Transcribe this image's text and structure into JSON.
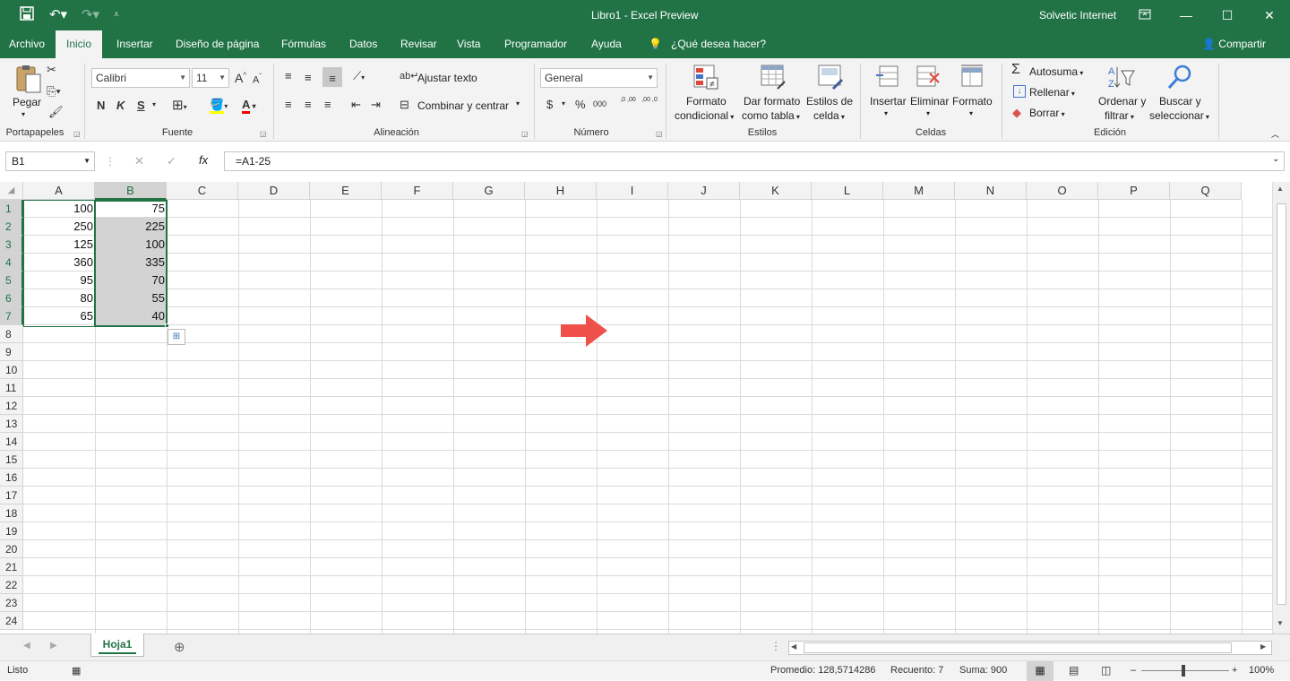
{
  "titlebar": {
    "quick_access": [
      "save-icon",
      "undo-icon",
      "redo-icon",
      "customize-icon"
    ],
    "title": "Libro1  -  Excel Preview",
    "account": "Solvetic Internet",
    "window_controls": [
      "ribbon-display-icon",
      "minimize-icon",
      "maximize-icon",
      "close-icon"
    ]
  },
  "tabs": [
    {
      "label": "Archivo"
    },
    {
      "label": "Inicio",
      "active": true
    },
    {
      "label": "Insertar"
    },
    {
      "label": "Diseño de página"
    },
    {
      "label": "Fórmulas"
    },
    {
      "label": "Datos"
    },
    {
      "label": "Revisar"
    },
    {
      "label": "Vista"
    },
    {
      "label": "Programador"
    },
    {
      "label": "Ayuda"
    }
  ],
  "tellme": "¿Qué desea hacer?",
  "share": "Compartir",
  "ribbon": {
    "clipboard": {
      "paste": "Pegar",
      "group": "Portapapeles"
    },
    "font": {
      "name": "Calibri",
      "size": "11",
      "bold": "N",
      "italic": "K",
      "underline": "S",
      "group": "Fuente",
      "increase": "A",
      "decrease": "A"
    },
    "alignment": {
      "wrap": "Ajustar texto",
      "merge": "Combinar y centrar",
      "group": "Alineación"
    },
    "number": {
      "format": "General",
      "currency": "$",
      "percent": "%",
      "thousands": "000",
      "inc_dec": ",0 ,00",
      "dec_dec": ",00 ,0",
      "group": "Número"
    },
    "styles": {
      "conditional": [
        "Formato",
        "condicional"
      ],
      "table": [
        "Dar formato",
        "como tabla"
      ],
      "cell": [
        "Estilos de",
        "celda"
      ],
      "group": "Estilos"
    },
    "cells": {
      "insert": "Insertar",
      "delete": "Eliminar",
      "format": "Formato",
      "group": "Celdas"
    },
    "editing": {
      "autosum": "Autosuma",
      "fill": "Rellenar",
      "clear": "Borrar",
      "sort": [
        "Ordenar y",
        "filtrar"
      ],
      "find": [
        "Buscar y",
        "seleccionar"
      ],
      "group": "Edición"
    }
  },
  "formula_bar": {
    "name_box": "B1",
    "cancel": "✕",
    "enter": "✓",
    "fx": "fx",
    "formula": "=A1-25"
  },
  "columns": [
    "A",
    "B",
    "C",
    "D",
    "E",
    "F",
    "G",
    "H",
    "I",
    "J",
    "K",
    "L",
    "M",
    "N",
    "O",
    "P",
    "Q"
  ],
  "rows": [
    "1",
    "2",
    "3",
    "4",
    "5",
    "6",
    "7",
    "8",
    "9",
    "10",
    "11",
    "12",
    "13",
    "14",
    "15",
    "16",
    "17",
    "18",
    "19",
    "20",
    "21",
    "22",
    "23",
    "24"
  ],
  "cells": {
    "A": [
      "100",
      "250",
      "125",
      "360",
      "95",
      "80",
      "65"
    ],
    "B": [
      "75",
      "225",
      "100",
      "335",
      "70",
      "55",
      "40"
    ]
  },
  "selected_column": "B",
  "sheet": {
    "tab": "Hoja1"
  },
  "status": {
    "ready": "Listo",
    "average": "Promedio: 128,5714286",
    "count": "Recuento: 7",
    "sum": "Suma: 900",
    "zoom": "100%"
  }
}
